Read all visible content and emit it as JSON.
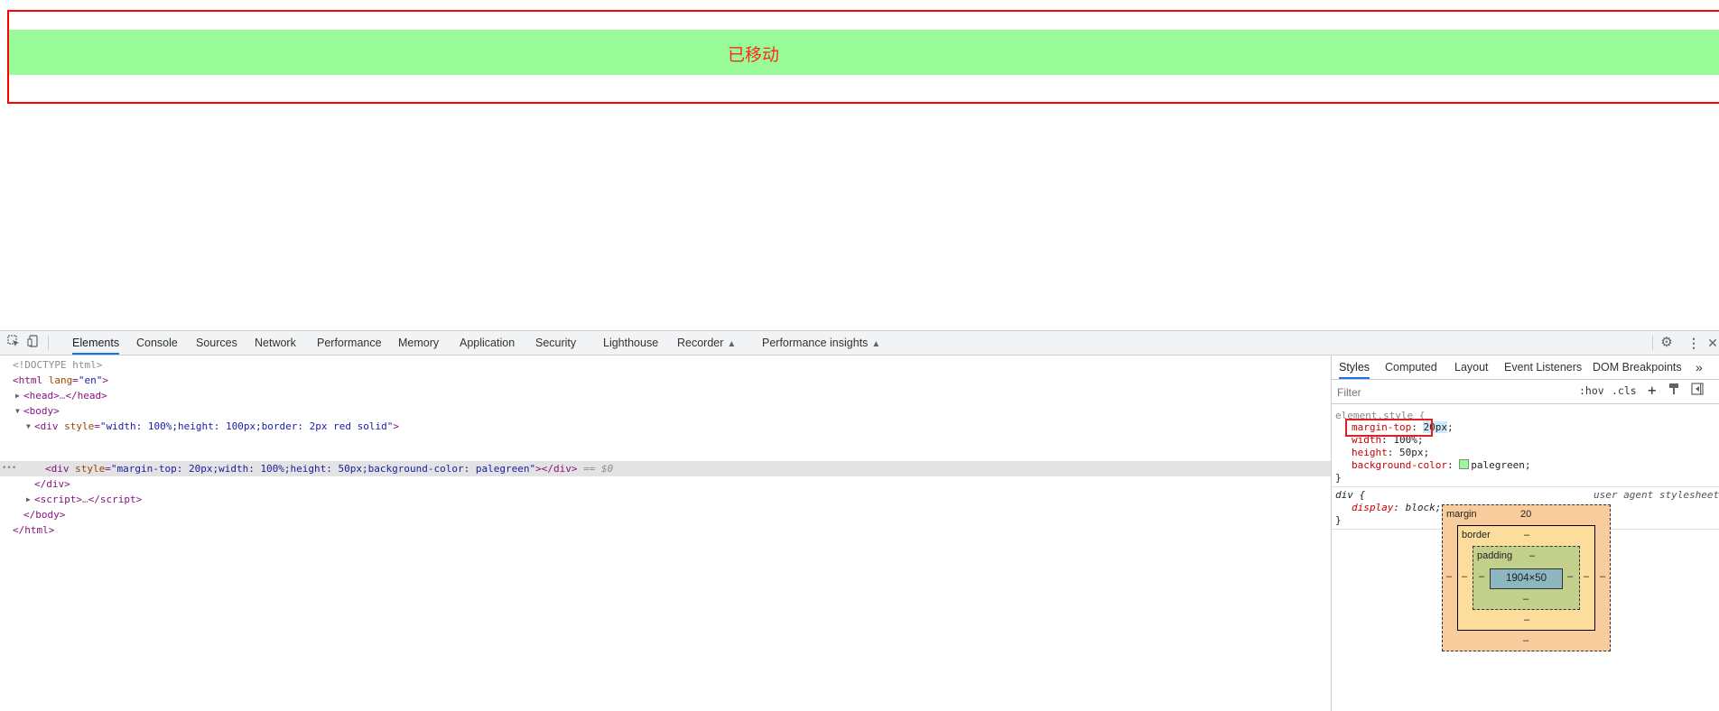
{
  "page": {
    "moved_text": "已移动"
  },
  "devtools": {
    "tabs": [
      "Elements",
      "Console",
      "Sources",
      "Network",
      "Performance",
      "Memory",
      "Application",
      "Security",
      "Lighthouse",
      "Recorder",
      "Performance insights"
    ],
    "active_tab": "Elements",
    "dom": {
      "doctype": "<!DOCTYPE html>",
      "html_open_tag": "html",
      "html_attr": "lang",
      "html_val": "\"en\"",
      "head": "head",
      "head_ellipsis": "…",
      "body": "body",
      "div1_tag": "div",
      "div1_attr": "style",
      "div1_val": "\"width: 100%;height: 100px;border: 2px red solid\"",
      "div2_tag": "div",
      "div2_attr": "style",
      "div2_val": "\"margin-top: 20px;width: 100%;height: 50px;background-color: palegreen\"",
      "div2_marker": " == $0",
      "row_dots": "•••",
      "script": "script",
      "script_ellipsis": "…",
      "close_div": "</div>",
      "close_body": "</body>",
      "close_html": "</html>"
    },
    "styles": {
      "tabs": [
        "Styles",
        "Computed",
        "Layout",
        "Event Listeners",
        "DOM Breakpoints"
      ],
      "more_tabs": "»",
      "active_tab": "Styles",
      "filter_placeholder": "Filter",
      "hov_button": ":hov",
      "cls_button": ".cls",
      "element_style_selector": "element.style {",
      "rules": [
        {
          "prop": "margin-top",
          "value": "20px"
        },
        {
          "prop": "width",
          "value": "100%"
        },
        {
          "prop": "height",
          "value": "50px"
        },
        {
          "prop": "background-color",
          "value": "palegreen"
        }
      ],
      "close_brace": "}",
      "ua_selector": "div {",
      "ua_source": "user agent stylesheet",
      "ua_prop": "display",
      "ua_value": "block",
      "swatch_color": "#98fb98"
    },
    "box_model": {
      "margin_label": "margin",
      "margin_top": "20",
      "margin_right": "–",
      "margin_bottom": "–",
      "margin_left": "–",
      "border_label": "border",
      "border_top": "–",
      "border_right": "–",
      "border_bottom": "–",
      "border_left": "–",
      "padding_label": "padding",
      "padding_top": "–",
      "padding_right": "–",
      "padding_bottom": "–",
      "padding_left": "–",
      "content": "1904×50"
    }
  }
}
